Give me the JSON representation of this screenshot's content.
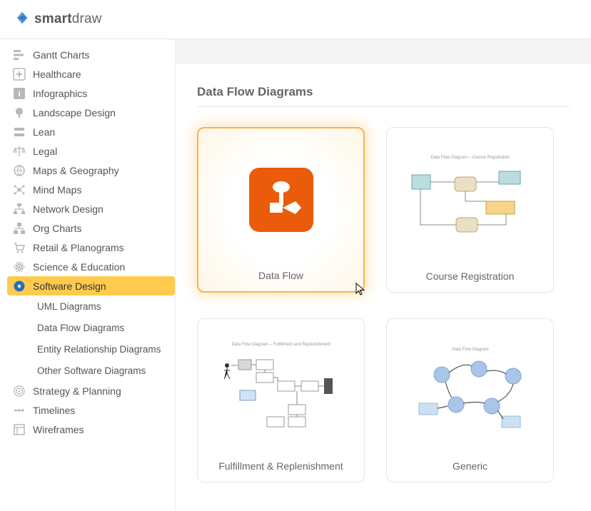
{
  "brand": {
    "name_bold": "smart",
    "name_rest": "draw"
  },
  "sidebar": {
    "items": [
      {
        "label": "Gantt Charts",
        "icon": "gantt"
      },
      {
        "label": "Healthcare",
        "icon": "plus"
      },
      {
        "label": "Infographics",
        "icon": "info"
      },
      {
        "label": "Landscape Design",
        "icon": "tree"
      },
      {
        "label": "Lean",
        "icon": "lean"
      },
      {
        "label": "Legal",
        "icon": "scale"
      },
      {
        "label": "Maps & Geography",
        "icon": "globe"
      },
      {
        "label": "Mind Maps",
        "icon": "mind"
      },
      {
        "label": "Network Design",
        "icon": "network"
      },
      {
        "label": "Org Charts",
        "icon": "org"
      },
      {
        "label": "Retail & Planograms",
        "icon": "cart"
      },
      {
        "label": "Science & Education",
        "icon": "atom"
      },
      {
        "label": "Software Design",
        "icon": "disc",
        "active": true
      },
      {
        "label": "Strategy & Planning",
        "icon": "target"
      },
      {
        "label": "Timelines",
        "icon": "timeline"
      },
      {
        "label": "Wireframes",
        "icon": "wireframe"
      }
    ],
    "subitems": [
      {
        "label": "UML Diagrams"
      },
      {
        "label": "Data Flow Diagrams"
      },
      {
        "label": "Entity Relationship Diagrams"
      },
      {
        "label": "Other Software Diagrams"
      }
    ]
  },
  "page": {
    "title": "Data Flow Diagrams"
  },
  "templates": [
    {
      "label": "Data Flow",
      "selected": true,
      "preview": "dataflow-icon"
    },
    {
      "label": "Course Registration",
      "preview": "course-reg"
    },
    {
      "label": "Fulfillment & Replenishment",
      "preview": "fulfillment"
    },
    {
      "label": "Generic",
      "preview": "generic"
    }
  ]
}
